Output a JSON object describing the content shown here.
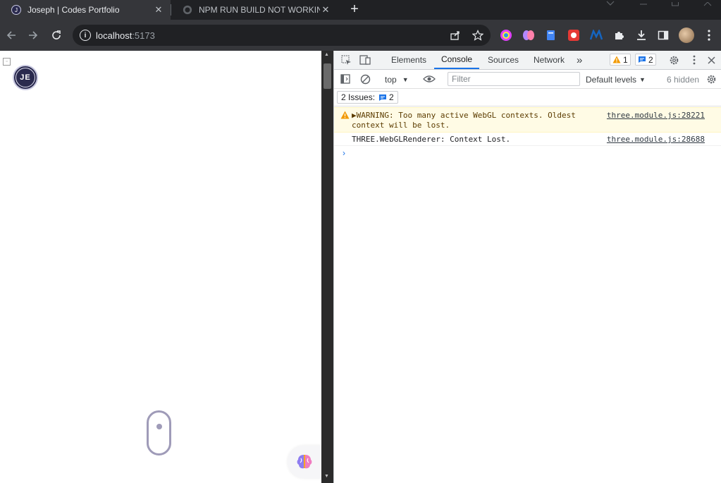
{
  "browser": {
    "tabs": [
      {
        "title": "Joseph | Codes Portfolio",
        "active": true
      },
      {
        "title": "NPM RUN BUILD NOT WORKING",
        "active": false
      }
    ],
    "new_tab": "+",
    "close": "✕",
    "url_host": "localhost",
    "url_port": ":5173"
  },
  "page": {
    "logo_text": "JE"
  },
  "devtools": {
    "tabs": [
      "Elements",
      "Console",
      "Sources",
      "Network"
    ],
    "more": "»",
    "warn_count": "1",
    "info_count": "2",
    "context": "top",
    "filter_placeholder": "Filter",
    "levels": "Default levels",
    "hidden": "6 hidden",
    "issues_label": "2 Issues:",
    "issues_count": "2",
    "messages": [
      {
        "level": "warning",
        "text": "▶WARNING: Too many active WebGL contexts. Oldest context will be lost.",
        "source": "three.module.js:28221"
      },
      {
        "level": "info",
        "text": "THREE.WebGLRenderer: Context Lost.",
        "source": "three.module.js:28688"
      }
    ],
    "prompt": "›"
  },
  "colors": {
    "chrome_dark": "#202124",
    "toolbar": "#35363a",
    "accent": "#1a73e8",
    "warning_bg": "#fffbe5",
    "logo_bg": "#2a2a4e"
  }
}
